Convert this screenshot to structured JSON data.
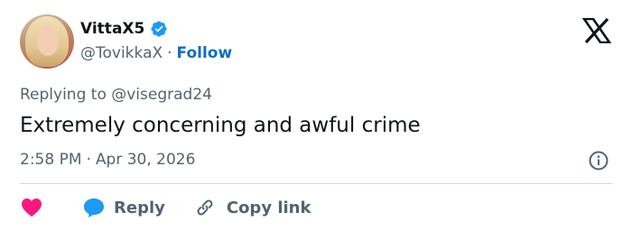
{
  "author": {
    "display_name": "VittaX5",
    "handle": "@TovikkaX",
    "separator": "·",
    "follow_label": "Follow"
  },
  "tweet": {
    "replying_to": "Replying to @visegrad24",
    "text": "Extremely concerning and awful crime",
    "time": "2:58 PM",
    "separator": "·",
    "date": "Apr 30, 2026"
  },
  "actions": {
    "reply_label": "Reply",
    "copy_link_label": "Copy link"
  },
  "colors": {
    "text_primary": "#0f1419",
    "text_secondary": "#536471",
    "link_blue": "#0f6fbf",
    "verified_blue": "#1d9bf0",
    "heart_pink": "#f91880",
    "reply_blue": "#1d9bf0",
    "divider": "#cfd9de"
  },
  "icons": [
    "verified-badge-icon",
    "x-logo-icon",
    "info-icon",
    "heart-icon",
    "reply-bubble-icon",
    "link-icon"
  ]
}
